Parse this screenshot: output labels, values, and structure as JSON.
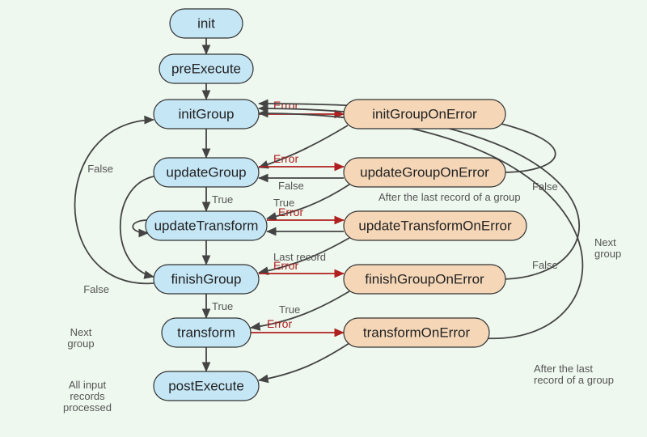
{
  "nodes": {
    "init": "init",
    "preExecute": "preExecute",
    "initGroup": "initGroup",
    "updateGroup": "updateGroup",
    "updateTransform": "updateTransform",
    "finishGroup": "finishGroup",
    "transform": "transform",
    "postExecute": "postExecute",
    "initGroupOnError": "initGroupOnError",
    "updateGroupOnError": "updateGroupOnError",
    "updateTransformOnError": "updateTransformOnError",
    "finishGroupOnError": "finishGroupOnError",
    "transformOnError": "transformOnError"
  },
  "labels": {
    "error": "Error",
    "false": "False",
    "true": "True",
    "lastRecord": "Last record",
    "afterLastRecordOfGroup": "After the last record of a group",
    "afterLastRecordOfGroup2a": "After the last",
    "afterLastRecordOfGroup2b": "record of a group",
    "nextGroup": "Next",
    "nextGroup2": "group",
    "nextGroupSide": "Next",
    "nextGroupSide2": "group",
    "allInputRecords1": "All input",
    "allInputRecords2": "records",
    "allInputRecords3": "processed"
  }
}
